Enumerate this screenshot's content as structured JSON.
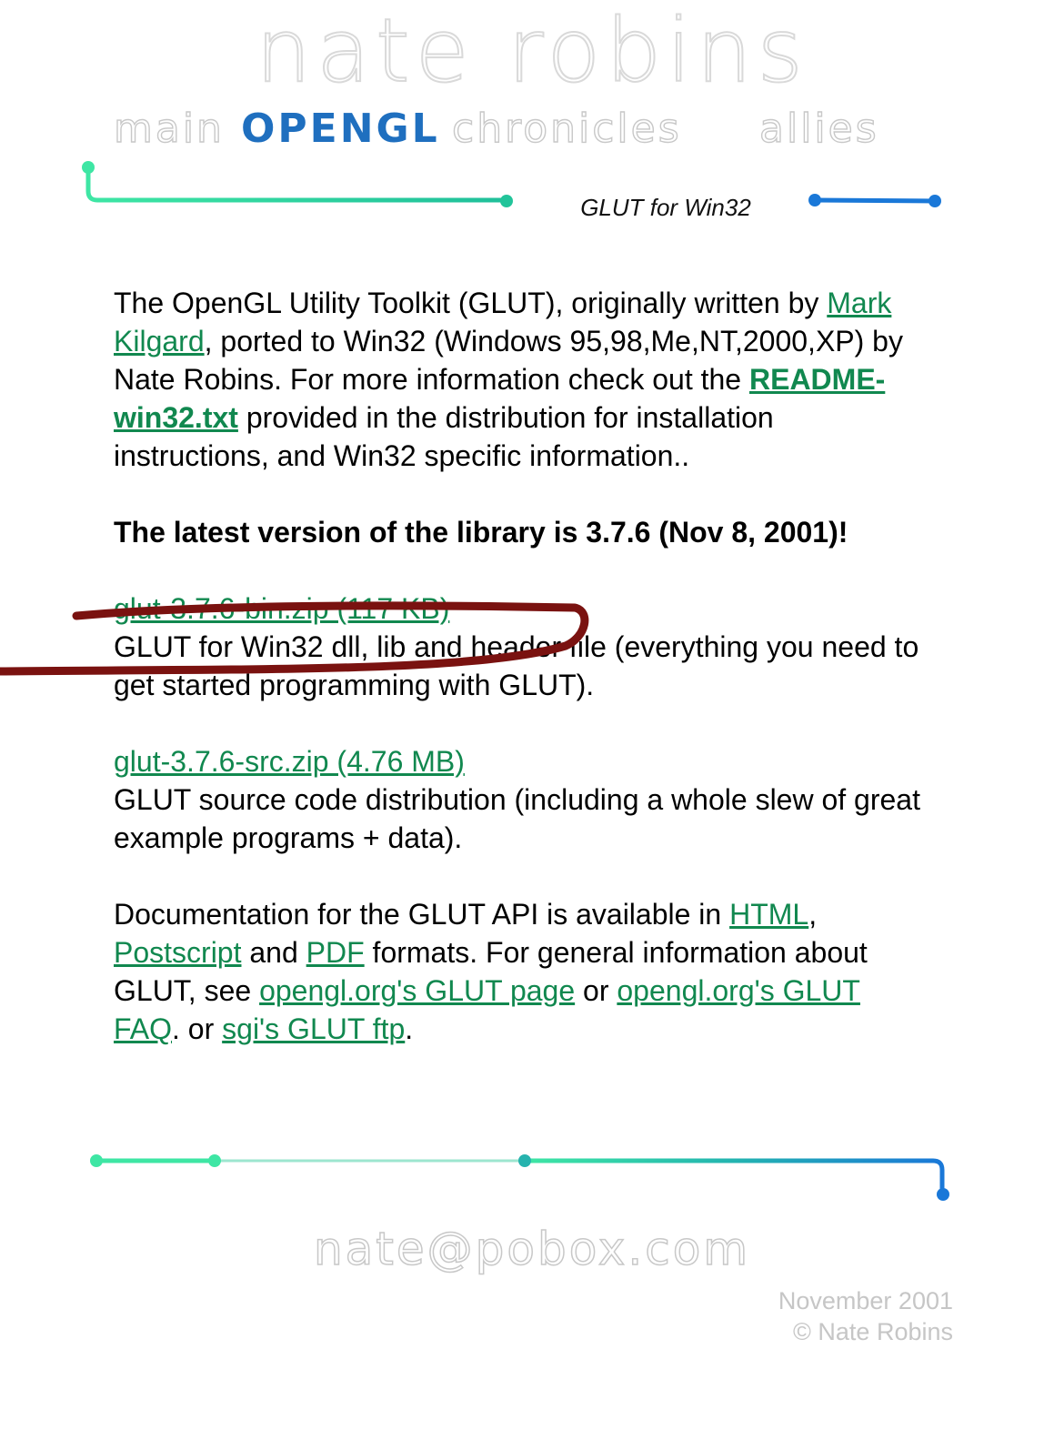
{
  "header": {
    "logo_text": "nate robins"
  },
  "nav": {
    "items": [
      {
        "label": "main"
      },
      {
        "label": "OPENGL"
      },
      {
        "label": "chronicles"
      },
      {
        "label": "allies"
      }
    ]
  },
  "page": {
    "subtitle": "GLUT for Win32"
  },
  "intro": {
    "text_1": "The OpenGL Utility Toolkit (GLUT), originally written by ",
    "link_kilgard": "Mark Kilgard",
    "text_2": ", ported to Win32 (Windows 95,98,Me,NT,2000,XP) by Nate Robins. For more information check out the ",
    "link_readme": "README-win32.txt",
    "text_3": " provided in the distribution for installation instructions, and Win32 specific information.."
  },
  "latest": {
    "text": "The latest version of the library is 3.7.6 (Nov 8, 2001)!"
  },
  "downloads": [
    {
      "link": "glut-3.7.6-bin.zip (117 KB)",
      "description": "GLUT for Win32 dll, lib and header file (everything you need to get started programming with GLUT)."
    },
    {
      "link": "glut-3.7.6-src.zip (4.76 MB)",
      "description": "GLUT source code distribution (including a whole slew of great example programs + data)."
    }
  ],
  "docs": {
    "text_1": "Documentation for the GLUT API is available in ",
    "link_html": "HTML",
    "text_2": ", ",
    "link_postscript": "Postscript",
    "text_3": " and ",
    "link_pdf": "PDF",
    "text_4": " formats. For general information about GLUT, see ",
    "link_glut_page": "opengl.org's GLUT page",
    "text_5": " or ",
    "link_glut_faq": "opengl.org's GLUT FAQ",
    "text_6": ". or ",
    "link_sgi": "sgi's GLUT ftp",
    "text_7": "."
  },
  "footer": {
    "email": "nate@pobox.com",
    "date": "November 2001",
    "copyright": "© Nate Robins"
  },
  "colors": {
    "link": "#11884f",
    "nav_active": "#1f6fbf",
    "line_green": "#3ee0a0",
    "line_blue": "#1a78d8",
    "annotation": "#7a1210"
  }
}
